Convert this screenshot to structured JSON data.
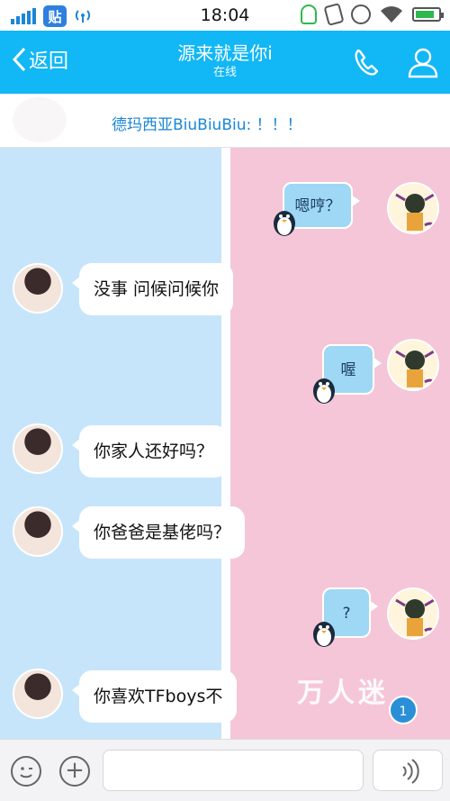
{
  "status_bar": {
    "time": "18:04",
    "tieba_badge": "贴",
    "icons": [
      "signal-icon",
      "tieba-icon",
      "hotspot-icon",
      "bulb-icon",
      "rotate-icon",
      "alarm-icon",
      "wifi-icon",
      "battery-icon"
    ]
  },
  "header": {
    "back_label": "返回",
    "title": "源来就是你i",
    "subtitle": "在线",
    "accent": "#12b7f5"
  },
  "banner": {
    "text": "德玛西亚BiuBiuBiu: ！！！"
  },
  "messages": [
    {
      "side": "out",
      "text": "嗯哼？"
    },
    {
      "side": "in",
      "text": "没事 问候问候你"
    },
    {
      "side": "out",
      "text": "喔"
    },
    {
      "side": "in",
      "text": "你家人还好吗？"
    },
    {
      "side": "in",
      "text": "你爸爸是基佬吗？"
    },
    {
      "side": "out",
      "text": "?"
    },
    {
      "side": "in",
      "text": "你喜欢TFboys不"
    }
  ],
  "chat_overlay": {
    "watermark": "万人迷",
    "unread_count": "1"
  },
  "input_bar": {
    "placeholder": "",
    "icons": [
      "emoji-icon",
      "plus-icon",
      "voice-icon"
    ]
  },
  "colors": {
    "left_panel": "#c7e5fa",
    "right_panel": "#f4c6d8",
    "out_bubble": "#9fd8f5"
  }
}
